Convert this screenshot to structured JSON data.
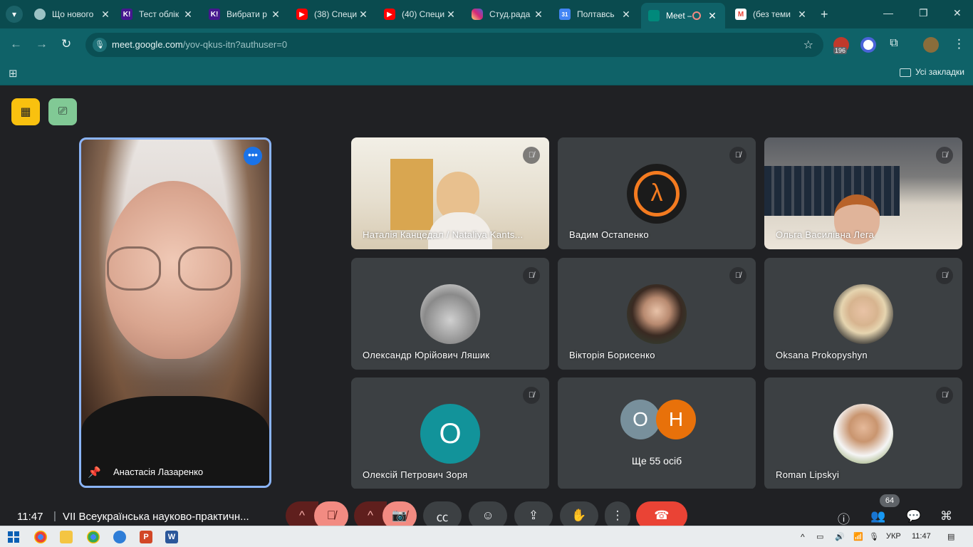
{
  "browser": {
    "tabs": [
      {
        "label": "Що нового",
        "favicon": "chrome-icon",
        "color": "#9cc2c4"
      },
      {
        "label": "Тест облік",
        "favicon": "kahoot-icon",
        "color": "#46178f"
      },
      {
        "label": "Вибрати р",
        "favicon": "kahoot-icon",
        "color": "#46178f"
      },
      {
        "label": "(38) Специ",
        "favicon": "youtube-icon",
        "color": "#ff0000"
      },
      {
        "label": "(40) Специ",
        "favicon": "youtube-icon",
        "color": "#ff0000"
      },
      {
        "label": "Студ.рада",
        "favicon": "instagram-icon",
        "color": "#d62976"
      },
      {
        "label": "Полтавсь",
        "favicon": "calendar-icon",
        "color": "#4285f4"
      },
      {
        "label": "Meet –",
        "favicon": "meet-icon",
        "color": "#00897b",
        "active": true
      },
      {
        "label": "(без теми",
        "favicon": "gmail-icon",
        "color": "#ea4335"
      }
    ],
    "calendar_day": "31",
    "url_host": "meet.google.com",
    "url_path": "/yov-qkus-itn?authuser=0",
    "extension_badge": "196",
    "all_bookmarks": "Усі закладки"
  },
  "meet": {
    "pinned": {
      "name": "Анастасія Лазаренко"
    },
    "tiles": [
      {
        "name": "Наталія Канцедал / Nataliya Kants...",
        "kind": "video",
        "muted": true
      },
      {
        "name": "Вадим Остапенко",
        "kind": "avatar",
        "muted": true
      },
      {
        "name": "Ольга Василівна Лега",
        "kind": "video",
        "muted": true
      },
      {
        "name": "Олександр Юрійович Ляшик",
        "kind": "avatar",
        "muted": true
      },
      {
        "name": "Вікторія Борисенко",
        "kind": "avatar",
        "muted": true
      },
      {
        "name": "Oksana Prokopyshyn",
        "kind": "avatar",
        "muted": true
      },
      {
        "name": "Олексій Петрович Зоря",
        "kind": "letter",
        "letter": "О",
        "muted": true
      },
      {
        "name": "Ще 55 осіб",
        "kind": "group",
        "letters": [
          "О",
          "Н"
        ],
        "muted": false
      },
      {
        "name": "Roman Lipskyi",
        "kind": "avatar",
        "muted": true
      }
    ],
    "clock": "11:47",
    "separator": "|",
    "meeting_title": "VII Всеукраїнська науково-практичн...",
    "participant_count": "64"
  },
  "taskbar": {
    "language": "УКР",
    "time": "11:47"
  }
}
